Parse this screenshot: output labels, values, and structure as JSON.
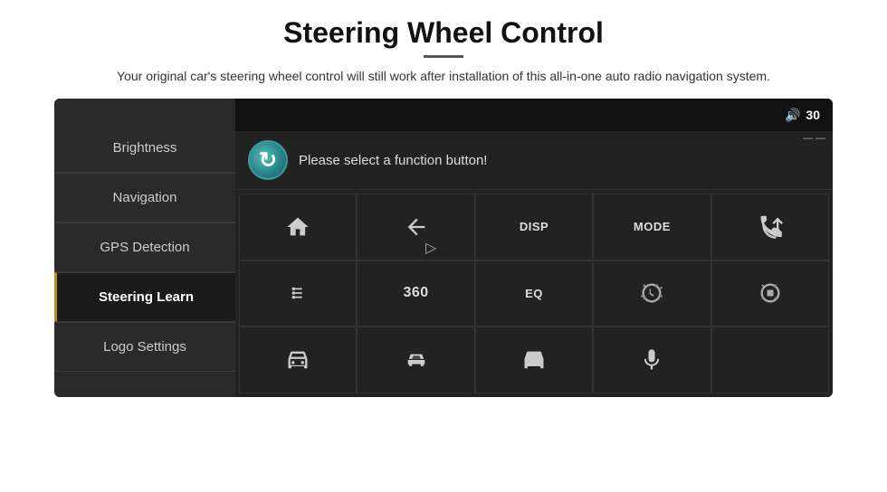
{
  "header": {
    "title": "Steering Wheel Control",
    "divider": true,
    "subtitle": "Your original car's steering wheel control will still work after installation of this all-in-one auto radio navigation system."
  },
  "topbar": {
    "volume_label": "30"
  },
  "sidebar": {
    "items": [
      {
        "id": "brightness",
        "label": "Brightness",
        "active": false
      },
      {
        "id": "navigation",
        "label": "Navigation",
        "active": false
      },
      {
        "id": "gps",
        "label": "GPS Detection",
        "active": false
      },
      {
        "id": "steering",
        "label": "Steering Learn",
        "active": true
      },
      {
        "id": "logo",
        "label": "Logo Settings",
        "active": false
      }
    ]
  },
  "function_area": {
    "refresh_icon": "↻",
    "prompt": "Please select a function button!",
    "grid": [
      {
        "row": 1,
        "col": 1,
        "type": "icon",
        "icon": "home",
        "label": ""
      },
      {
        "row": 1,
        "col": 2,
        "type": "icon",
        "icon": "back",
        "label": ""
      },
      {
        "row": 1,
        "col": 3,
        "type": "text",
        "label": "DISP"
      },
      {
        "row": 1,
        "col": 4,
        "type": "text",
        "label": "MODE"
      },
      {
        "row": 1,
        "col": 5,
        "type": "icon",
        "icon": "phone-mute",
        "label": ""
      },
      {
        "row": 2,
        "col": 1,
        "type": "icon",
        "icon": "equalizer-bars",
        "label": ""
      },
      {
        "row": 2,
        "col": 2,
        "type": "text",
        "label": "360"
      },
      {
        "row": 2,
        "col": 3,
        "type": "text",
        "label": "EQ"
      },
      {
        "row": 2,
        "col": 4,
        "type": "icon",
        "icon": "camera-front",
        "label": ""
      },
      {
        "row": 2,
        "col": 5,
        "type": "icon",
        "icon": "camera-rear",
        "label": ""
      },
      {
        "row": 3,
        "col": 1,
        "type": "icon",
        "icon": "car-front",
        "label": ""
      },
      {
        "row": 3,
        "col": 2,
        "type": "icon",
        "icon": "car-side",
        "label": ""
      },
      {
        "row": 3,
        "col": 3,
        "type": "icon",
        "icon": "car-top",
        "label": ""
      },
      {
        "row": 3,
        "col": 4,
        "type": "icon",
        "icon": "microphone",
        "label": ""
      },
      {
        "row": 3,
        "col": 5,
        "type": "empty",
        "label": ""
      }
    ]
  }
}
